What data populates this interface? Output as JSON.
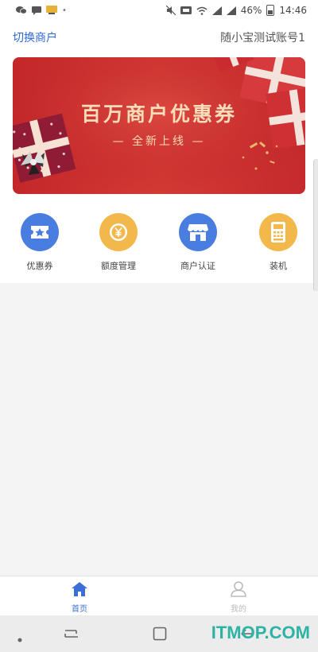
{
  "status_bar": {
    "battery": "46%",
    "time": "14:46"
  },
  "header": {
    "switch_merchant": "切换商户",
    "account_name": "随小宝测试账号1"
  },
  "banner": {
    "title": "百万商户优惠券",
    "subtitle": "— 全新上线 —"
  },
  "quick_actions": [
    {
      "label": "优惠券",
      "icon": "coupon-icon",
      "color": "#4a7de0"
    },
    {
      "label": "额度管理",
      "icon": "yen-coin-icon",
      "color": "#f2b84b"
    },
    {
      "label": "商户认证",
      "icon": "storefront-icon",
      "color": "#4a7de0"
    },
    {
      "label": "装机",
      "icon": "pos-terminal-icon",
      "color": "#f2b84b"
    }
  ],
  "tabs": [
    {
      "label": "首页",
      "icon": "home-icon",
      "active": true
    },
    {
      "label": "我的",
      "icon": "user-icon",
      "active": false
    }
  ],
  "watermark": "ITMOP.COM",
  "colors": {
    "accent": "#2d6ad8",
    "active_tab": "#3b6fd6",
    "inactive_tab": "#bbbbbb",
    "banner_red": "#c8302f",
    "banner_text": "#f6dcb8"
  }
}
